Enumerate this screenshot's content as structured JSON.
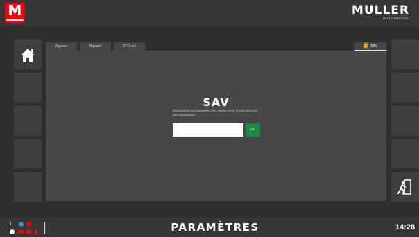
{
  "app": {
    "logo_letter": "M",
    "brand_name": "MULLER",
    "brand_sub": "AUTOMOTIVE"
  },
  "tabs": [
    {
      "label": "Agence"
    },
    {
      "label": "Rapport"
    },
    {
      "label": "DTCLink"
    },
    {
      "label": "SAV",
      "active": true,
      "icon": "lock-icon"
    }
  ],
  "sav": {
    "title": "SAV",
    "description": "Afin d'accéder aux paramètres SAV, veuillez entrer le code fourni par votre interlocuteur.",
    "code_value": "",
    "go_label": "GO"
  },
  "footer": {
    "title": "PARAMÈTRES",
    "time": "14:28"
  },
  "colors": {
    "accent_red": "#e30613",
    "go_green": "#1e8a44",
    "lock_orange": "#e8a317"
  }
}
